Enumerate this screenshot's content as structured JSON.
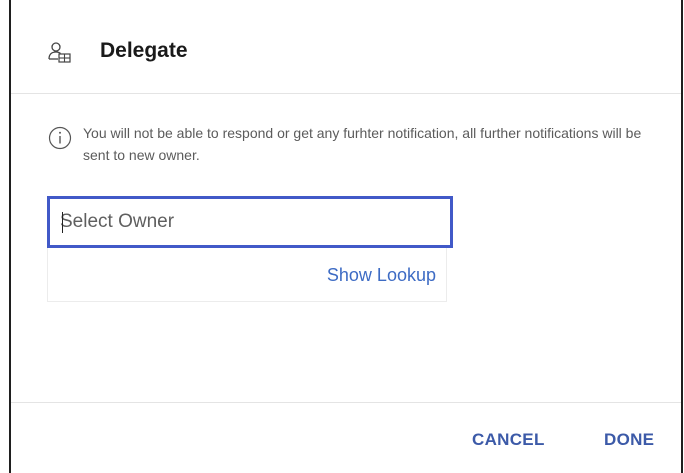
{
  "dialog": {
    "title": "Delegate",
    "icon": "user-group-icon"
  },
  "info": {
    "icon": "info-icon",
    "message": "You will not be able to respond or get any furhter notification, all further notifications will be sent to new owner."
  },
  "owner_field": {
    "placeholder": "Select Owner",
    "value": ""
  },
  "lookup": {
    "label": "Show Lookup"
  },
  "footer": {
    "cancel_label": "CANCEL",
    "done_label": "DONE"
  },
  "colors": {
    "accent": "#4159c8",
    "link": "#3d6bc4",
    "button": "#3c5aa8"
  }
}
